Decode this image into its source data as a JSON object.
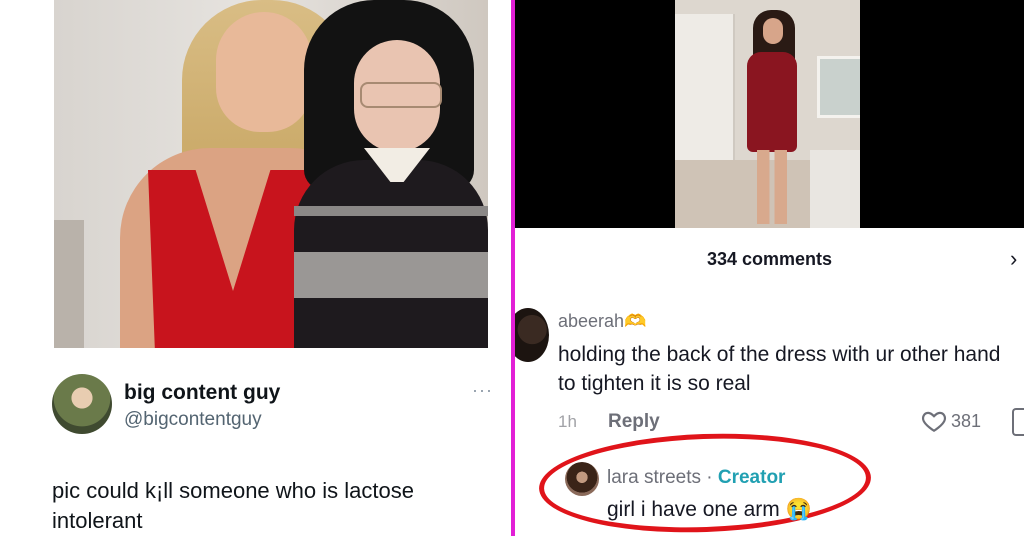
{
  "tweet": {
    "display_name": "big content guy",
    "handle": "@bigcontentguy",
    "more": "···",
    "text": "pic could k¡ll someone who is lactose intolerant"
  },
  "tiktok": {
    "comments_count_label": "334 comments",
    "close": "›",
    "comment": {
      "username": "abeerah🫶",
      "text": "holding the back of the dress with ur other hand to tighten it is so real",
      "time": "1h",
      "reply_label": "Reply",
      "likes": "381"
    },
    "reply": {
      "username": "lara streets",
      "separator": " · ",
      "badge": "Creator",
      "text": "girl i have one arm 😭"
    }
  },
  "colors": {
    "divider": "#e21fd6",
    "highlight_ring": "#e0141a",
    "creator_badge": "#21a0b2"
  }
}
